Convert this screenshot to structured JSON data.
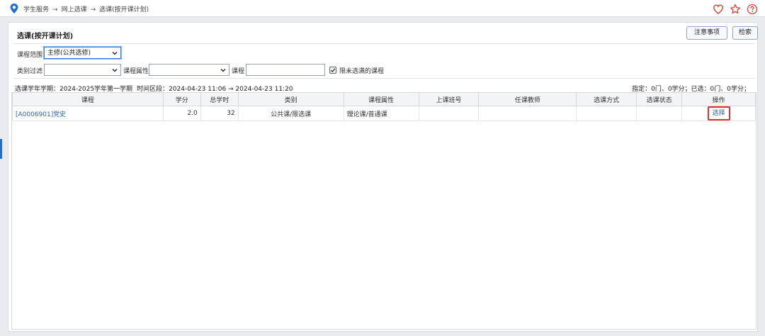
{
  "breadcrumb": [
    "学生服务",
    "网上选课",
    "选课(按开课计划)"
  ],
  "breadcrumb_separator": "→",
  "top_icons": [
    "heart-icon",
    "star-icon",
    "help-icon"
  ],
  "panel": {
    "title": "选课(按开课计划)",
    "buttons": {
      "notes": "注意事项",
      "search": "检索"
    }
  },
  "filters": {
    "scope_label": "课程范围",
    "scope_value": "主修(公共选修)",
    "category_label": "类别过滤",
    "category_value": "",
    "attribute_label": "课程属性",
    "attribute_value": "",
    "course_label": "课程",
    "course_value": "",
    "limit_label": "限未选满的课程",
    "limit_checked": true
  },
  "info": {
    "term": "选课学年学期：2024-2025学年第一学期",
    "time": "时间区段：2024-04-23 11:06 → 2024-04-23 11:20",
    "summary": "指定：0门、0学分；已选：0门、0学分；"
  },
  "table": {
    "columns": [
      "课程",
      "学分",
      "总学时",
      "类别",
      "课程属性",
      "上课班号",
      "任课教师",
      "选课方式",
      "选课状态",
      "操作"
    ],
    "rows": [
      {
        "course": "[A0006901]党史",
        "credits": "2.0",
        "hours": "32",
        "category": "公共课/限选课",
        "attribute": "理论课/普通课",
        "class_no": "",
        "teacher": "",
        "method": "",
        "status": "",
        "action": "选择"
      }
    ]
  },
  "colors": {
    "accent": "#1f6fd1",
    "link": "#2e64b8",
    "highlight": "#e53030",
    "icon_red": "#e0423a"
  }
}
